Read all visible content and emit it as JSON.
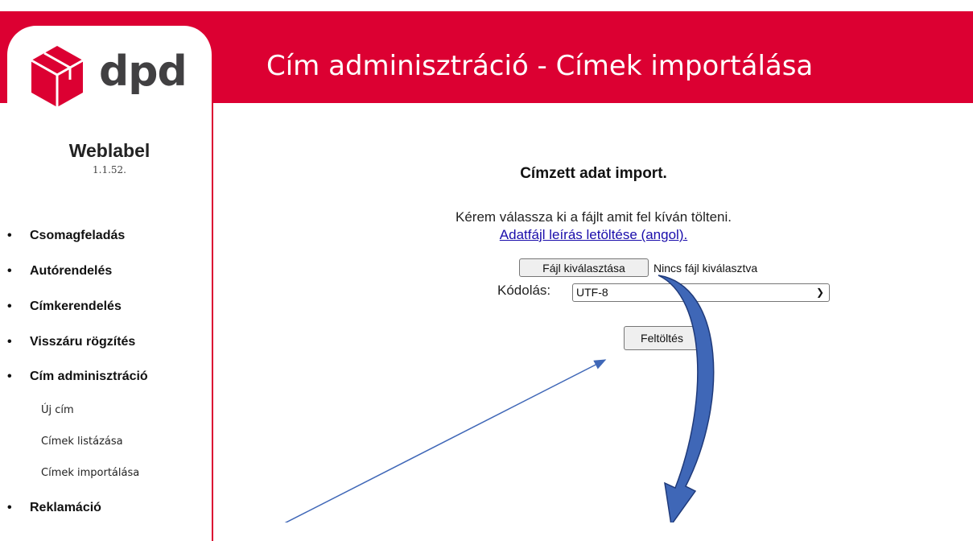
{
  "header": {
    "title": "Cím adminisztráció - Címek importálása"
  },
  "logo": {
    "text": "dpd"
  },
  "app": {
    "name": "Weblabel",
    "version": "1.1.52."
  },
  "nav": {
    "items": [
      {
        "label": "Csomagfeladás"
      },
      {
        "label": "Autórendelés"
      },
      {
        "label": "Címkerendelés"
      },
      {
        "label": "Visszáru rögzítés"
      },
      {
        "label": "Cím adminisztráció"
      },
      {
        "label": "Reklamáció"
      }
    ],
    "subitems": [
      {
        "label": "Új cím"
      },
      {
        "label": "Címek listázása"
      },
      {
        "label": "Címek importálása"
      }
    ]
  },
  "main": {
    "title": "Címzett adat import.",
    "instruction": "Kérem válassza ki a fájlt amit fel kíván tölteni.",
    "help_link": "Adatfájl leírás letöltése (angol).",
    "file_button": "Fájl kiválasztása",
    "file_status": "Nincs fájl kiválasztva",
    "encoding_label": "Kódolás:",
    "encoding_value": "UTF-8",
    "upload_button": "Feltöltés"
  },
  "colors": {
    "brand_red": "#dc0032",
    "link": "#1a0dab",
    "annotation_blue": "#3f67b7"
  }
}
